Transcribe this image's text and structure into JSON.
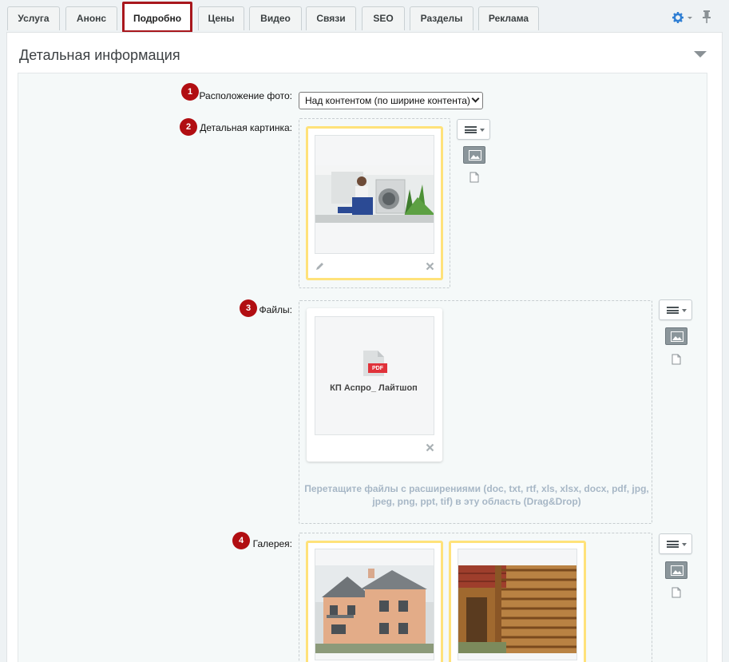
{
  "tabs": [
    "Услуга",
    "Анонс",
    "Подробно",
    "Цены",
    "Видео",
    "Связи",
    "SEO",
    "Разделы",
    "Реклама"
  ],
  "active_tab": "Подробно",
  "panel": {
    "title": "Детальная информация"
  },
  "fields": {
    "photo_position": {
      "num": "1",
      "label": "Расположение фото:",
      "value": "Над контентом (по ширине контента)"
    },
    "detail_picture": {
      "num": "2",
      "label": "Детальная картинка:"
    },
    "files": {
      "num": "3",
      "label": "Файлы:",
      "file_name": "КП Аспро_ Лайтшоп",
      "file_badge": "PDF",
      "hint": "Перетащите файлы с расширениями (doc, txt, rtf, xls, xlsx, docx, pdf, jpg, jpeg, png, ppt, tif) в эту область (Drag&Drop)"
    },
    "gallery": {
      "num": "4",
      "label": "Галерея:"
    }
  },
  "icons": {
    "settings": "gear-icon",
    "pin": "pin-icon",
    "collapse": "triangle-down-icon",
    "menu": "hamburger-menu-icon",
    "image": "image-icon",
    "file": "file-icon",
    "edit": "pencil-icon",
    "delete": "close-icon"
  },
  "colors": {
    "accent": "#a8171d",
    "number_badge": "#b10e12",
    "selected_border": "#ffe27a",
    "hint": "#a7b7c6",
    "settings_blue": "#2f7fd4"
  }
}
